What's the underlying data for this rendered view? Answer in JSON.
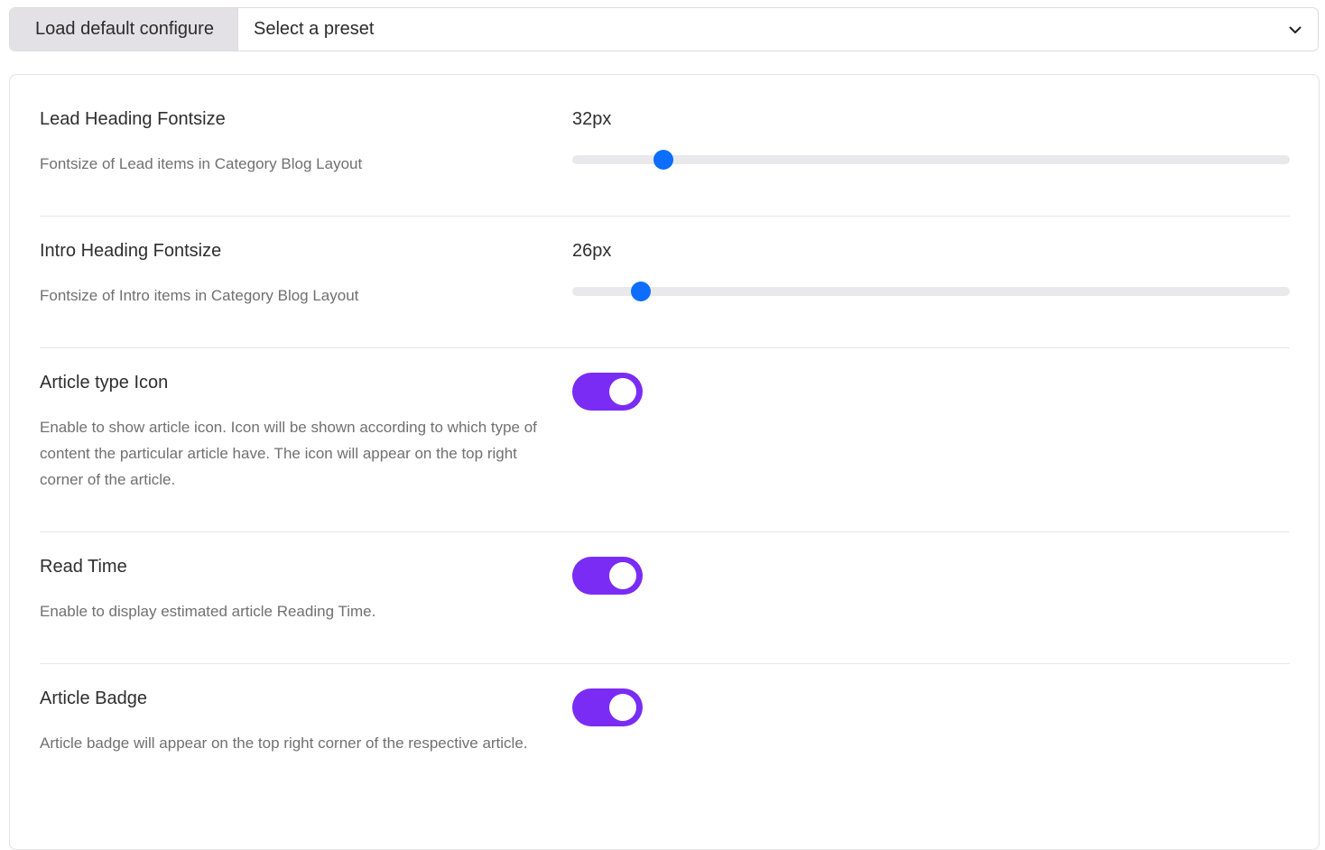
{
  "preset": {
    "load_label": "Load default configure",
    "select_value": "Select a preset"
  },
  "settings": [
    {
      "title": "Lead Heading Fontsize",
      "description": "Fontsize of Lead items in Category Blog Layout",
      "value_label": "32px",
      "slider_fraction": 0.127
    },
    {
      "title": "Intro Heading Fontsize",
      "description": "Fontsize of Intro items in Category Blog Layout",
      "value_label": "26px",
      "slider_fraction": 0.095
    },
    {
      "title": "Article type Icon",
      "description": "Enable to show article icon. Icon will be shown according to which type of content the particular article have. The icon will appear on the top right corner of the article.",
      "enabled": true
    },
    {
      "title": "Read Time",
      "description": "Enable to display estimated article Reading Time.",
      "enabled": true
    },
    {
      "title": "Article Badge",
      "description": "Article badge will appear on the top right corner of the respective article.",
      "enabled": true
    }
  ],
  "colors": {
    "slider_thumb": "#0d6efd",
    "toggle_on": "#7a2cf5",
    "load_button_bg": "#e3e1e6"
  },
  "icons": {
    "select_caret": "chevron-down-icon"
  }
}
